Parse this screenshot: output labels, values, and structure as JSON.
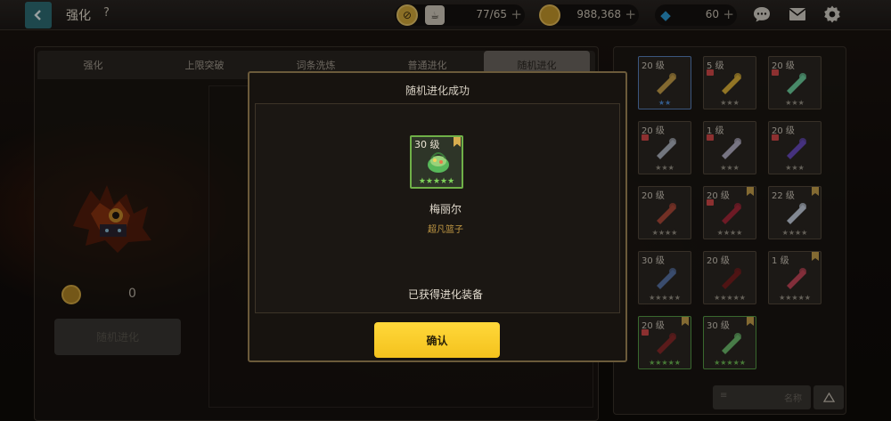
{
  "header": {
    "title": "强化",
    "help": "?",
    "stamina": "77/65",
    "gold": "988,368",
    "gems": "60",
    "plus": "+"
  },
  "tabs": [
    "强化",
    "上限突破",
    "词条洗炼",
    "普通进化",
    "随机进化"
  ],
  "active_tab": 4,
  "left": {
    "cost": "0",
    "evolve_button": "随机进化"
  },
  "modal": {
    "title": "随机进化成功",
    "item_level": "30",
    "item_level_unit": "级",
    "item_stars": "★★★★★",
    "item_name": "梅丽尔",
    "item_type": "超凡篮子",
    "result_text": "已获得进化装备",
    "confirm": "确认"
  },
  "inventory": [
    {
      "level": "20",
      "unit": "级",
      "stars": "★★",
      "star_color": "blue",
      "locked": false,
      "bookmark": false
    },
    {
      "level": "5",
      "unit": "级",
      "stars": "★★★",
      "star_color": "grey",
      "locked": true,
      "bookmark": false
    },
    {
      "level": "20",
      "unit": "级",
      "stars": "★★★",
      "star_color": "grey",
      "locked": true,
      "bookmark": false
    },
    {
      "level": "20",
      "unit": "级",
      "stars": "★★★",
      "star_color": "grey",
      "locked": true,
      "bookmark": false
    },
    {
      "level": "1",
      "unit": "级",
      "stars": "★★★",
      "star_color": "grey",
      "locked": true,
      "bookmark": false
    },
    {
      "level": "20",
      "unit": "级",
      "stars": "★★★",
      "star_color": "grey",
      "locked": true,
      "bookmark": false
    },
    {
      "level": "20",
      "unit": "级",
      "stars": "★★★★",
      "star_color": "grey",
      "locked": false,
      "bookmark": false
    },
    {
      "level": "20",
      "unit": "级",
      "stars": "★★★★",
      "star_color": "grey",
      "locked": true,
      "bookmark": true
    },
    {
      "level": "22",
      "unit": "级",
      "stars": "★★★★",
      "star_color": "grey",
      "locked": false,
      "bookmark": true
    },
    {
      "level": "30",
      "unit": "级",
      "stars": "★★★★★",
      "star_color": "grey",
      "locked": false,
      "bookmark": false
    },
    {
      "level": "20",
      "unit": "级",
      "stars": "★★★★★",
      "star_color": "grey",
      "locked": false,
      "bookmark": false
    },
    {
      "level": "1",
      "unit": "级",
      "stars": "★★★★★",
      "star_color": "grey",
      "locked": false,
      "bookmark": true
    },
    {
      "level": "20",
      "unit": "级",
      "stars": "★★★★★",
      "star_color": "green",
      "locked": true,
      "bookmark": true
    },
    {
      "level": "30",
      "unit": "级",
      "stars": "★★★★★",
      "star_color": "green",
      "locked": false,
      "bookmark": true
    }
  ],
  "sort": {
    "icon": "≡",
    "label": "名称"
  },
  "icons": [
    "back-arrow-icon",
    "stamina-icon",
    "coffee-icon",
    "gold-coin-icon",
    "gem-icon",
    "chat-icon",
    "mail-icon",
    "gear-icon",
    "lock-icon",
    "bookmark-icon",
    "triangle-icon"
  ]
}
